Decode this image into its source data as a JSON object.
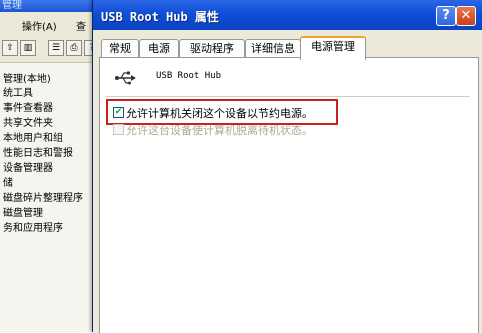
{
  "background_window": {
    "title": "管理",
    "menu": [
      "操作(A)",
      "查"
    ],
    "tree": [
      "管理(本地)",
      "统工具",
      "事件查看器",
      "共享文件夹",
      "本地用户和组",
      "性能日志和警报",
      "设备管理器",
      "储",
      "磁盘碎片整理程序",
      "磁盘管理",
      "务和应用程序"
    ]
  },
  "dialog": {
    "title": "USB Root Hub 属性",
    "tabs": [
      "常规",
      "电源",
      "驱动程序",
      "详细信息",
      "电源管理"
    ],
    "active_tab_index": 4,
    "device_name": "USB Root Hub",
    "device_icon": "usb-icon",
    "options": [
      {
        "label": "允许计算机关闭这个设备以节约电源。",
        "checked": true,
        "enabled": true
      },
      {
        "label": "允许这台设备使计算机脱离待机状态。",
        "checked": false,
        "enabled": false
      }
    ],
    "caption_buttons": {
      "help": "?",
      "close": "✕"
    }
  },
  "colors": {
    "titlebar_blue": "#0a43c4",
    "highlight_red": "#cc1f1f",
    "dialog_bg": "#ece9d8",
    "active_tab_accent": "#f0a030"
  }
}
